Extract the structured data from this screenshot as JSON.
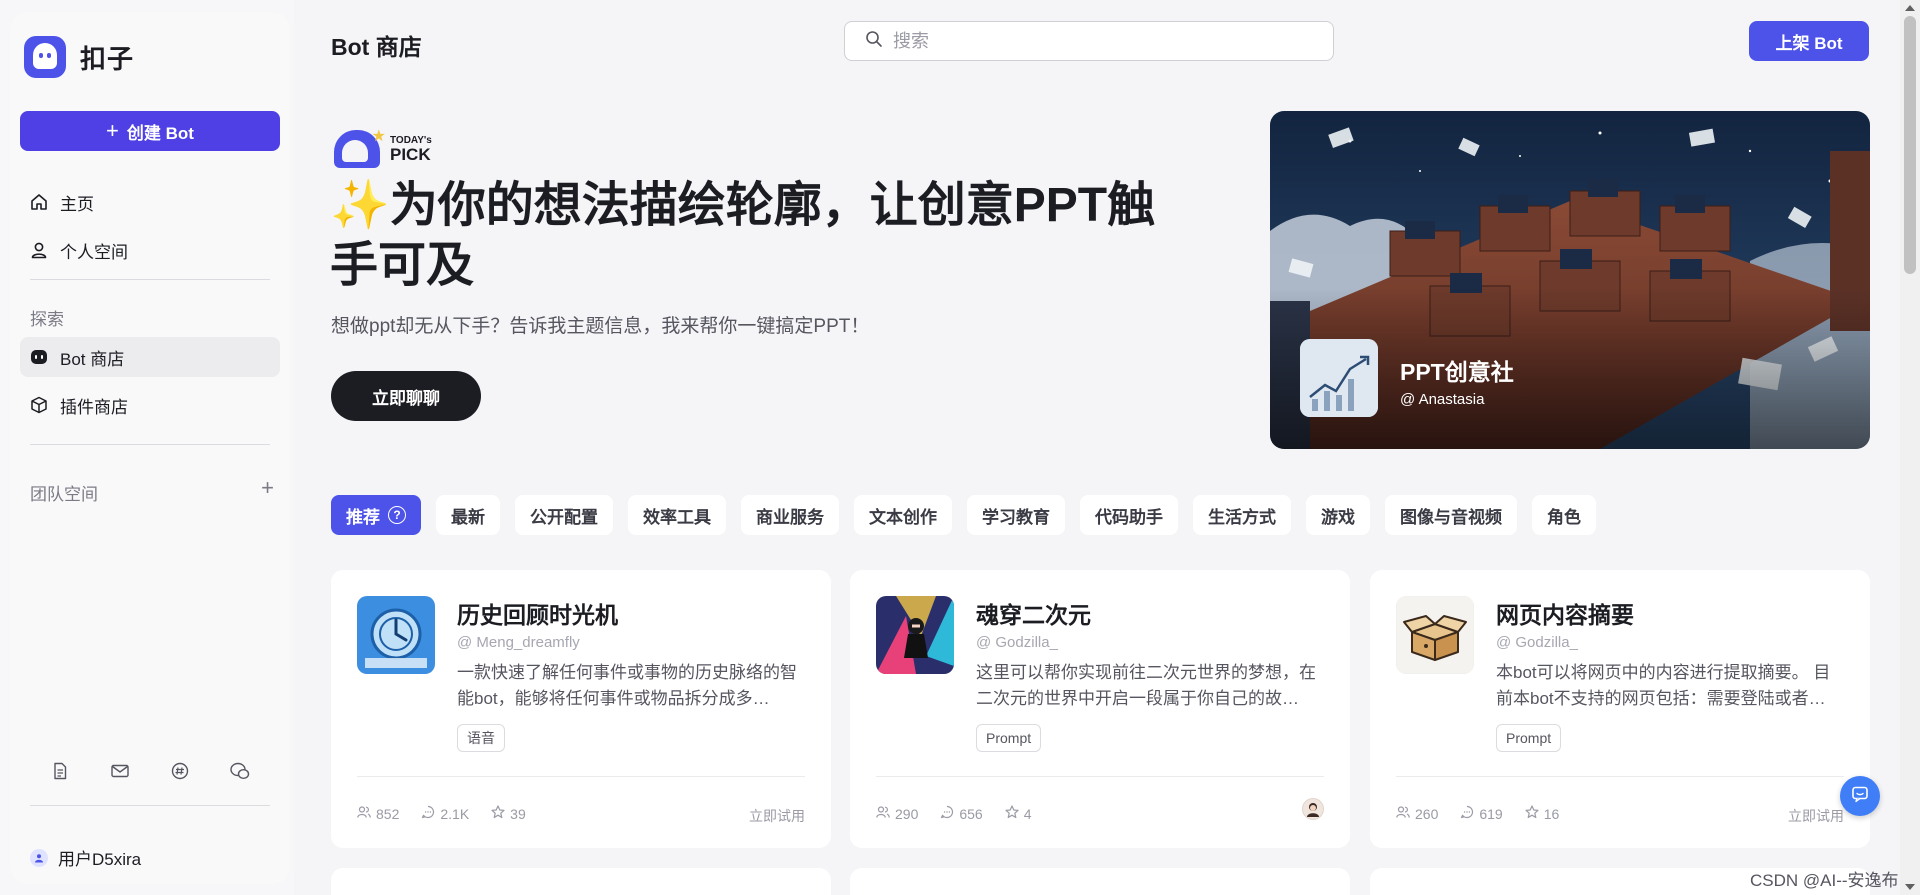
{
  "sidebar": {
    "brand_name": "扣子",
    "create_button": "创建 Bot",
    "nav": [
      {
        "label": "主页",
        "icon": "home-icon"
      },
      {
        "label": "个人空间",
        "icon": "user-icon"
      }
    ],
    "explore_label": "探索",
    "explore_items": [
      {
        "label": "Bot 商店",
        "icon": "bot-icon",
        "active": true
      },
      {
        "label": "插件商店",
        "icon": "cube-icon",
        "active": false
      }
    ],
    "team_label": "团队空间",
    "footer_icons": [
      "document-icon",
      "mail-icon",
      "discord-icon",
      "wechat-icon"
    ],
    "user_name": "用户D5xira"
  },
  "header": {
    "title": "Bot 商店",
    "search_placeholder": "搜索",
    "publish_button": "上架 Bot"
  },
  "hero": {
    "badge_small": "TODAY's",
    "badge_big": "PICK",
    "title_emoji": "✨",
    "title": "为你的想法描绘轮廓，让创意PPT触手可及",
    "subtitle": "想做ppt却无从下手？告诉我主题信息，我来帮你一键搞定PPT！",
    "cta": "立即聊聊",
    "bot_name": "PPT创意社",
    "bot_author": "@ Anastasia"
  },
  "tabs": [
    {
      "label": "推荐",
      "active": true
    },
    {
      "label": "最新"
    },
    {
      "label": "公开配置"
    },
    {
      "label": "效率工具"
    },
    {
      "label": "商业服务"
    },
    {
      "label": "文本创作"
    },
    {
      "label": "学习教育"
    },
    {
      "label": "代码助手"
    },
    {
      "label": "生活方式"
    },
    {
      "label": "游戏"
    },
    {
      "label": "图像与音视频"
    },
    {
      "label": "角色"
    }
  ],
  "cards": [
    {
      "title": "历史回顾时光机",
      "author": "@ Meng_dreamfly",
      "desc": "一款快速了解任何事件或事物的历史脉络的智能bot，能够将任何事件或物品拆分成多…",
      "tag": "语音",
      "users": "852",
      "chats": "2.1K",
      "stars": "39",
      "action": "立即试用"
    },
    {
      "title": "魂穿二次元",
      "author": "@ Godzilla_",
      "desc": "这里可以帮你实现前往二次元世界的梦想，在二次元的世界中开启一段属于你自己的故…",
      "tag": "Prompt",
      "users": "290",
      "chats": "656",
      "stars": "4",
      "action": ""
    },
    {
      "title": "网页内容摘要",
      "author": "@ Godzilla_",
      "desc": "本bot可以将网页中的内容进行提取摘要。 目前本bot不支持的网页包括：需要登陆或者…",
      "tag": "Prompt",
      "users": "260",
      "chats": "619",
      "stars": "16",
      "action": "立即试用"
    }
  ],
  "watermark": "CSDN @AI--安逸布",
  "colors": {
    "accent": "#4d53e8",
    "create_button": "#4e40e5",
    "background": "#f5f5f7",
    "float_button": "#3f7ef6"
  }
}
